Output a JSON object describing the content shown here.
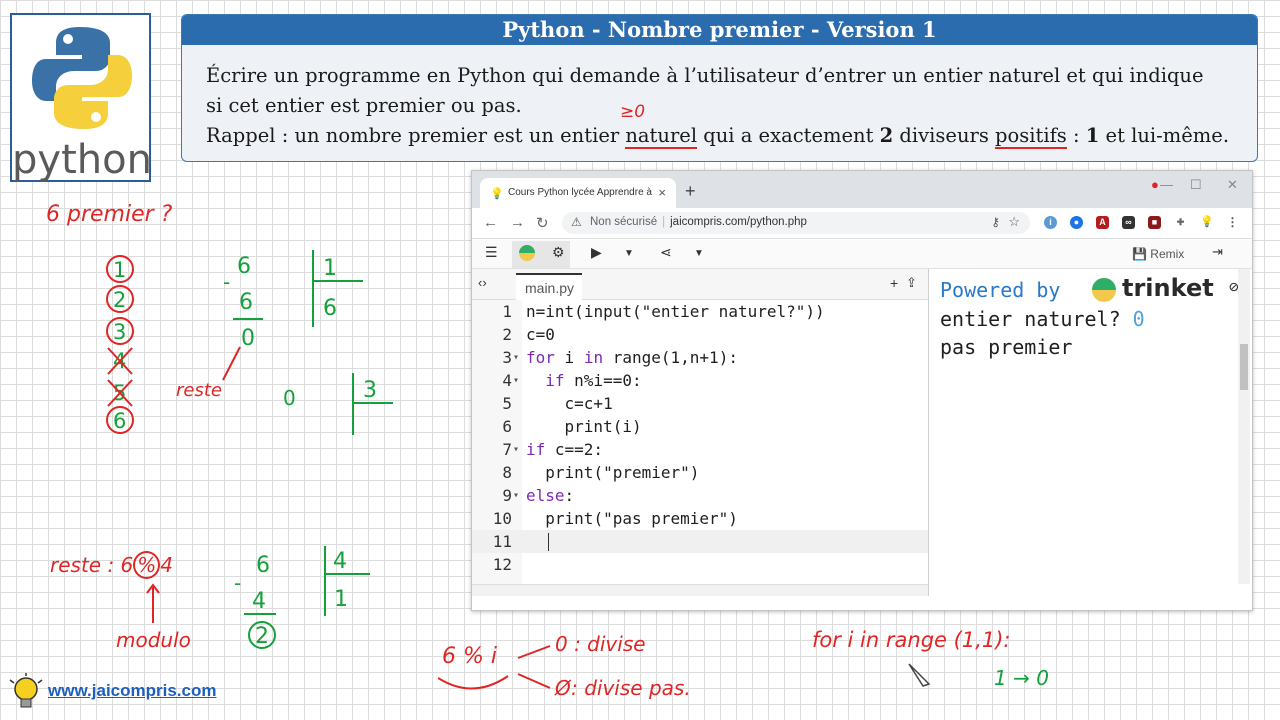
{
  "logo": {
    "word": "python"
  },
  "exercise": {
    "title": "Python - Nombre premier - Version 1",
    "line1": "Écrire un programme en Python qui demande à l’utilisateur d’entrer un entier naturel et qui indique",
    "line2": "si cet entier est premier ou pas.",
    "line3_a": "Rappel : un nombre premier est un entier ",
    "line3_naturel": "naturel",
    "line3_b": " qui a exactement ",
    "line3_two": "2",
    "line3_c": " diviseurs ",
    "line3_positifs": "positifs",
    "line3_d": " : ",
    "line3_one": "1",
    "line3_e": " et lui-même."
  },
  "browser": {
    "tab_title": "Cours Python lycée Apprendre à",
    "security": "Non sécurisé",
    "url": "jaicompris.com/python.php",
    "remix_label": "Remix",
    "file_tab": "main.py",
    "code": [
      {
        "n": "1",
        "fold": "",
        "text": "n=int(input(\"entier naturel?\"))"
      },
      {
        "n": "2",
        "fold": "",
        "text": "c=0"
      },
      {
        "n": "3",
        "fold": "▾",
        "text": "for i in range(1,n+1):"
      },
      {
        "n": "4",
        "fold": "▾",
        "text": "  if n%i==0:"
      },
      {
        "n": "5",
        "fold": "",
        "text": "    c=c+1"
      },
      {
        "n": "6",
        "fold": "",
        "text": "    print(i)"
      },
      {
        "n": "7",
        "fold": "▾",
        "text": "if c==2:"
      },
      {
        "n": "8",
        "fold": "",
        "text": "  print(\"premier\")"
      },
      {
        "n": "9",
        "fold": "▾",
        "text": "else:"
      },
      {
        "n": "10",
        "fold": "",
        "text": "  print(\"pas premier\")"
      },
      {
        "n": "11",
        "fold": "",
        "text": ""
      },
      {
        "n": "12",
        "fold": "",
        "text": ""
      }
    ],
    "powered_by": "Powered by",
    "brand": "trinket",
    "output_prompt": "entier naturel? ",
    "output_input": "0",
    "output_result": "pas premier"
  },
  "notes": {
    "six_premier": "6 premier ?",
    "reste": "reste",
    "reste_eq": "reste : 6",
    "percent": "%",
    "four": "4",
    "modulo": "modulo",
    "mod_expr": "6 % i",
    "zero_divise": "0 : divise",
    "divise_pas": ": divise pas.",
    "for_range": "for i in range (1,1):",
    "one_arrow_zero": "1 → 0",
    "ge_zero": "≥0"
  },
  "site": "www.jaicompris.com",
  "colors": {
    "title_bar": "#2a6cae",
    "ink_red": "#e02525",
    "ink_green": "#16a03b",
    "link": "#1c5fbf"
  }
}
